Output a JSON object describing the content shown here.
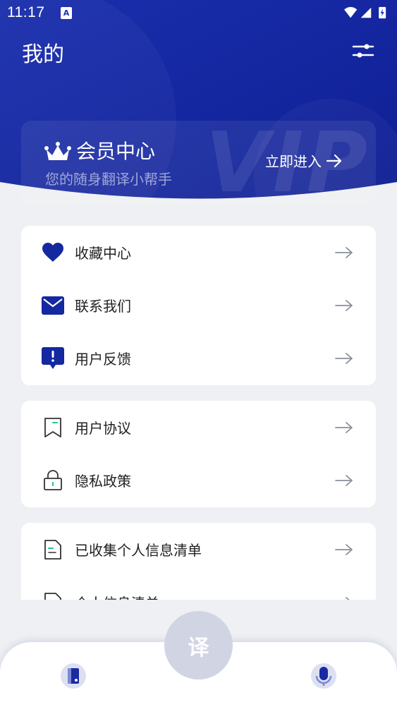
{
  "status_bar": {
    "time": "11:17",
    "notif_badge": "A"
  },
  "header": {
    "title": "我的"
  },
  "vip": {
    "watermark": "VIP",
    "title": "会员中心",
    "subtitle": "您的随身翻译小帮手",
    "enter_label": "立即进入"
  },
  "menu_group_1": [
    {
      "label": "收藏中心",
      "icon": "heart-icon"
    },
    {
      "label": "联系我们",
      "icon": "mail-icon"
    },
    {
      "label": "用户反馈",
      "icon": "feedback-icon"
    }
  ],
  "menu_group_2": [
    {
      "label": "用户协议",
      "icon": "bookmark-icon"
    },
    {
      "label": "隐私政策",
      "icon": "lock-icon"
    }
  ],
  "menu_group_3": [
    {
      "label": "已收集个人信息清单",
      "icon": "document-icon"
    },
    {
      "label": "个人信息清单",
      "icon": "document-icon"
    }
  ],
  "tabbar": {
    "center_label": "译"
  },
  "colors": {
    "primary": "#1428a0",
    "header_dark": "#0f1f93",
    "background": "#eef0f3"
  }
}
